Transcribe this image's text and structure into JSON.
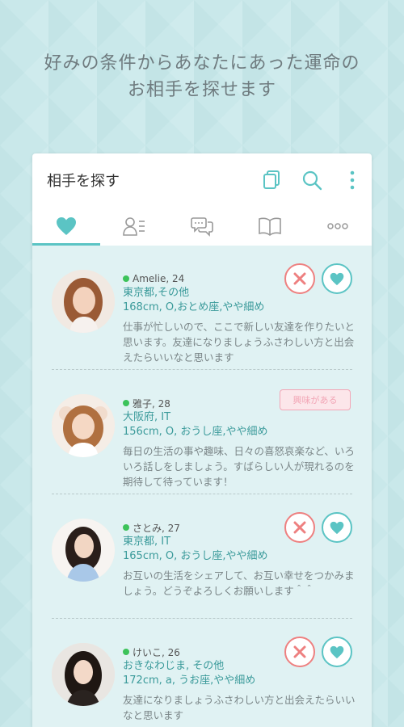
{
  "headline": {
    "line1": "好みの条件からあなたにあった運命の",
    "line2": "お相手を探せます"
  },
  "appbar": {
    "title": "相手を探す",
    "icons": [
      "copy-icon",
      "search-icon",
      "more-vert-icon"
    ]
  },
  "tabs": [
    {
      "icon": "heart-icon",
      "active": true
    },
    {
      "icon": "profile-list-icon",
      "active": false
    },
    {
      "icon": "chat-bubbles-icon",
      "active": false
    },
    {
      "icon": "book-icon",
      "active": false
    },
    {
      "icon": "more-horiz-icon",
      "active": false
    }
  ],
  "colors": {
    "accent": "#5bc4c4",
    "decline": "#ee8080",
    "online": "#3cc35a",
    "background": "#c9e8ea",
    "list_bg": "#e0f2f3"
  },
  "profiles": [
    {
      "name_age": "Amelie, 24",
      "location": "東京都,その他",
      "specs": "168cm, O,おとめ座,やや細め",
      "message": "仕事が忙しいので、ここで新しい友達を作りたいと思います。友達になりましょうふさわしい方と出会えたらいいなと思います",
      "status": "actions"
    },
    {
      "name_age": "雅子, 28",
      "location": "大阪府, IT",
      "specs": "156cm, O, おうし座,やや細め",
      "message": "毎日の生活の事や趣味、日々の喜怒哀楽など、いろいろ話しをしましょう。すばらしい人が現れるのを期待して待っています！",
      "status": "interested",
      "badge": "興味がある"
    },
    {
      "name_age": "さとみ, 27",
      "location": "東京都, IT",
      "specs": "165cm, O, おうし座,やや細め",
      "message": "お互いの生活をシェアして、お互い幸せをつかみましょう。どうぞよろしくお願いします＾＾",
      "status": "actions"
    },
    {
      "name_age": "けいこ, 26",
      "location": "おきなわじま, その他",
      "specs": "172cm, a, うお座,やや細め",
      "message": "友達になりましょうふさわしい方と出会えたらいいなと思います",
      "status": "actions"
    }
  ]
}
